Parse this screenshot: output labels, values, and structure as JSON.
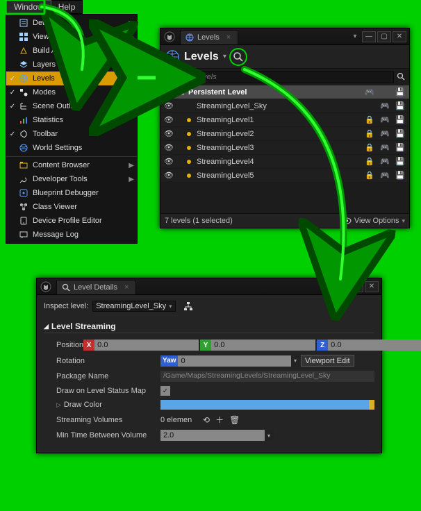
{
  "menubar": {
    "window": "Window",
    "help": "Help"
  },
  "dropdown": {
    "items": [
      {
        "check": false,
        "icon": "details-icon",
        "label": "Details",
        "sub": true
      },
      {
        "check": false,
        "icon": "viewports-icon",
        "label": "Viewports",
        "sub": true
      },
      {
        "check": false,
        "icon": "build-icon",
        "label": "Build And Submit",
        "sub": false
      },
      {
        "check": false,
        "icon": "layers-icon",
        "label": "Layers",
        "sub": false
      },
      {
        "check": true,
        "icon": "levels-icon",
        "label": "Levels",
        "sub": false,
        "hl": true
      },
      {
        "check": true,
        "icon": "modes-icon",
        "label": "Modes",
        "sub": false
      },
      {
        "check": true,
        "icon": "scene-icon",
        "label": "Scene Outliner",
        "sub": false
      },
      {
        "check": false,
        "icon": "stats-icon",
        "label": "Statistics",
        "sub": false
      },
      {
        "check": true,
        "icon": "toolbar-icon",
        "label": "Toolbar",
        "sub": false
      },
      {
        "check": false,
        "icon": "world-icon",
        "label": "World Settings",
        "sub": false
      }
    ],
    "items2": [
      {
        "icon": "content-icon",
        "label": "Content Browser",
        "sub": true
      },
      {
        "icon": "devtools-icon",
        "label": "Developer Tools",
        "sub": true
      },
      {
        "icon": "bp-icon",
        "label": "Blueprint Debugger",
        "sub": false
      },
      {
        "icon": "class-icon",
        "label": "Class Viewer",
        "sub": false
      },
      {
        "icon": "device-icon",
        "label": "Device Profile Editor",
        "sub": false
      },
      {
        "icon": "msg-icon",
        "label": "Message Log",
        "sub": false
      }
    ]
  },
  "levels_panel": {
    "tab": "Levels",
    "title": "Levels",
    "search_placeholder": "Search Levels",
    "rows": [
      {
        "persist": true,
        "dot": false,
        "name": "Persistent Level",
        "lock": false
      },
      {
        "persist": false,
        "dot": false,
        "name": "StreamingLevel_Sky",
        "lock": false
      },
      {
        "persist": false,
        "dot": true,
        "name": "StreamingLevel1",
        "lock": true
      },
      {
        "persist": false,
        "dot": true,
        "name": "StreamingLevel2",
        "lock": true
      },
      {
        "persist": false,
        "dot": true,
        "name": "StreamingLevel3",
        "lock": true
      },
      {
        "persist": false,
        "dot": true,
        "name": "StreamingLevel4",
        "lock": true
      },
      {
        "persist": false,
        "dot": true,
        "name": "StreamingLevel5",
        "lock": true
      }
    ],
    "status": "7 levels (1 selected)",
    "viewopt": "View Options"
  },
  "details_panel": {
    "tab": "Level Details",
    "inspect_label": "Inspect level:",
    "inspect_value": "StreamingLevel_Sky",
    "section": "Level Streaming",
    "props": {
      "position": {
        "label": "Position",
        "x": "0.0",
        "y": "0.0",
        "z": "0.0"
      },
      "rotation": {
        "label": "Rotation",
        "yaw_label": "Yaw",
        "yaw": "0",
        "viewport_btn": "Viewport Edit"
      },
      "package": {
        "label": "Package Name",
        "value": "/Game/Maps/StreamingLevels/StreamingLevel_Sky"
      },
      "drawmap": {
        "label": "Draw on Level Status Map",
        "checked": true
      },
      "drawcolor": {
        "label": "Draw Color"
      },
      "volumes": {
        "label": "Streaming Volumes",
        "count": "0 elemen"
      },
      "mintime": {
        "label": "Min Time Between Volume",
        "value": "2.0"
      }
    }
  }
}
